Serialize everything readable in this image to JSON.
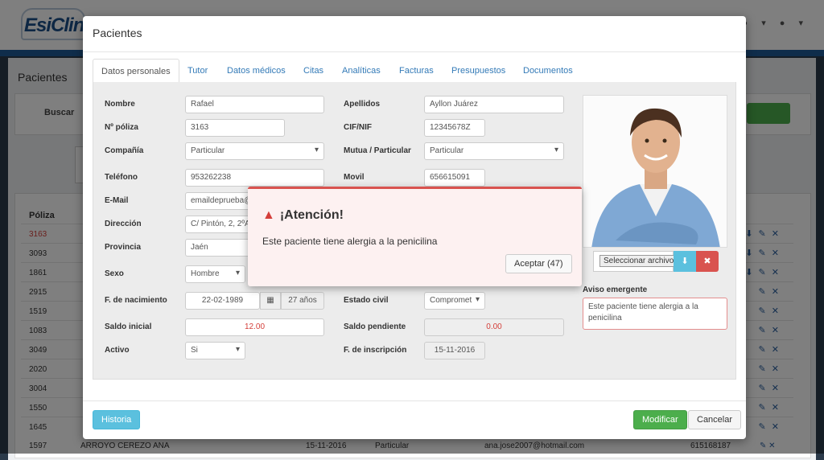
{
  "app": {
    "logo_text": "EsiClinic",
    "page_title": "Pacientes",
    "search_label": "Buscar",
    "user_icons": "● ▾   ● ▾"
  },
  "background_table": {
    "col_poliza": "Póliza",
    "rows": [
      {
        "poliza": "3163",
        "icons": "⬇ ✎ ✕"
      },
      {
        "poliza": "3093",
        "icons": "⬇ ✎ ✕"
      },
      {
        "poliza": "1861",
        "icons": "⬇ ✎ ✕"
      },
      {
        "poliza": "2915",
        "icons": "✎ ✕"
      },
      {
        "poliza": "1519",
        "icons": "✎ ✕"
      },
      {
        "poliza": "1083",
        "icons": "✎ ✕"
      },
      {
        "poliza": "3049",
        "icons": "✎ ✕"
      },
      {
        "poliza": "2020",
        "icons": "✎ ✕"
      },
      {
        "poliza": "3004",
        "icons": "✎ ✕"
      },
      {
        "poliza": "1550",
        "icons": "✎ ✕"
      },
      {
        "poliza": "1645",
        "icons": "✎ ✕"
      }
    ],
    "last_row": {
      "poliza": "1597",
      "name": "ARROYO CEREZO ANA",
      "date": "15-11-2016",
      "company": "Particular",
      "email": "ana.jose2007@hotmail.com",
      "phone": "615168187",
      "icons": "✎ ✕"
    }
  },
  "modal": {
    "title": "Pacientes",
    "tabs": [
      "Datos personales",
      "Tutor",
      "Datos médicos",
      "Citas",
      "Analíticas",
      "Facturas",
      "Presupuestos",
      "Documentos"
    ],
    "form": {
      "nombre_label": "Nombre",
      "nombre": "Rafael",
      "apellidos_label": "Apellidos",
      "apellidos": "Ayllon Juárez",
      "poliza_label": "Nº póliza",
      "poliza": "3163",
      "cif_label": "CIF/NIF",
      "cif": "12345678Z",
      "compania_label": "Compañía",
      "compania": "Particular",
      "mutua_label": "Mutua / Particular",
      "mutua": "Particular",
      "telefono_label": "Teléfono",
      "telefono": "953262238",
      "movil_label": "Movil",
      "movil": "656615091",
      "email_label": "E-Mail",
      "email": "emaildeprueba@",
      "direccion_label": "Dirección",
      "direccion": "C/ Pintón, 2, 2ºA",
      "provincia_label": "Provincia",
      "provincia": "Jaén",
      "sexo_label": "Sexo",
      "sexo": "Hombre",
      "nacimiento_label": "F. de nacimiento",
      "nacimiento": "22-02-1989",
      "edad": "27 años",
      "estado_civil_label": "Estado civil",
      "estado_civil": "Compromet",
      "saldo_inicial_label": "Saldo inicial",
      "saldo_inicial": "12.00",
      "saldo_pendiente_label": "Saldo pendiente",
      "saldo_pendiente": "0.00",
      "activo_label": "Activo",
      "activo": "Si",
      "inscripcion_label": "F. de inscripción",
      "inscripcion": "15-11-2016"
    },
    "file_button": "Seleccionar archivo",
    "aviso_label": "Aviso emergente",
    "aviso_text": "Este paciente tiene alergia a la penicilina",
    "buttons": {
      "historia": "Historia",
      "modificar": "Modificar",
      "cancelar": "Cancelar"
    }
  },
  "alert": {
    "title": "¡Atención!",
    "message": "Este paciente tiene alergia a la penicilina",
    "accept_button": "Aceptar (47)"
  },
  "colors": {
    "primary": "#337ab7",
    "success": "#4cae4c",
    "danger": "#d9534f",
    "info": "#5bc0de"
  }
}
